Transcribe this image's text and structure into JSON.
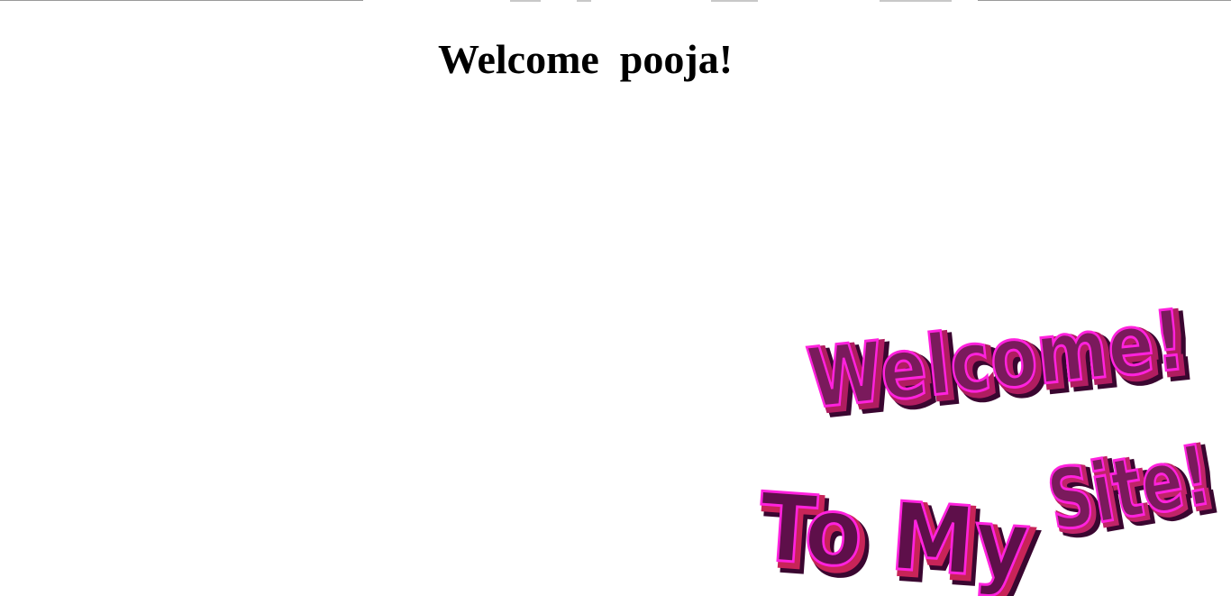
{
  "page": {
    "heading": "Welcome  pooja!"
  },
  "banner": {
    "line1": "Welcome!",
    "line2a": "To My",
    "line2b": "Site!",
    "colors": {
      "face": "#7a1a5c",
      "outline": "#ff22dd",
      "side": "#4a0a38",
      "alt_face": "#6b6a10",
      "alt_outline": "#e8ef20",
      "red_face": "#b81e4c",
      "red_outline": "#ff5070"
    }
  }
}
